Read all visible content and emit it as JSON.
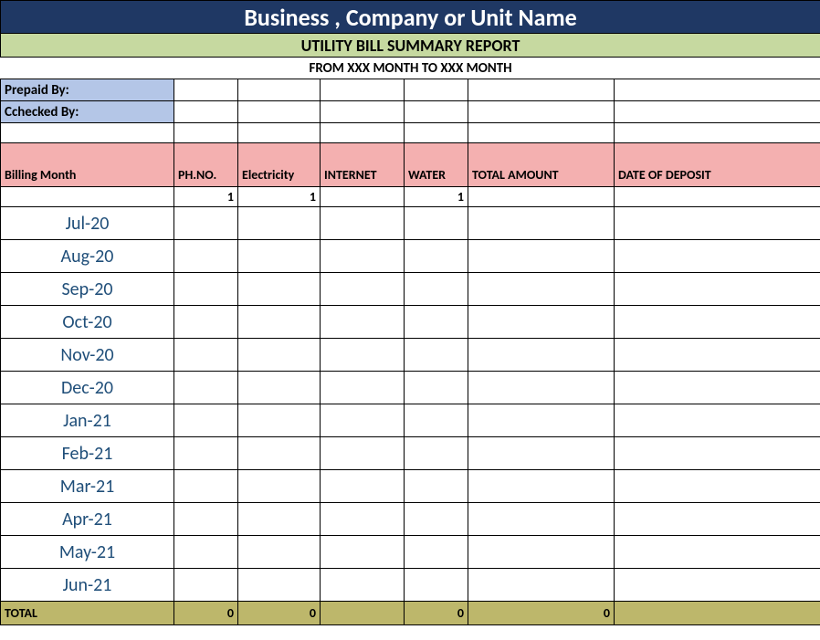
{
  "title": "Business , Company or Unit Name",
  "subtitle": "UTILITY BILL SUMMARY REPORT",
  "period": "FROM XXX MONTH  TO XXX MONTH",
  "meta": {
    "prepaid_label": "Prepaid By:",
    "checked_label": "Cchecked By:"
  },
  "columns": {
    "billing_month": "Billing Month",
    "phno": "PH.NO.",
    "electricity": "Electricity",
    "internet": "INTERNET",
    "water": "WATER",
    "total_amount": "TOTAL AMOUNT",
    "date_deposit": "DATE OF DEPOSIT"
  },
  "initial": {
    "phno": "1",
    "electricity": "1",
    "internet": "",
    "water": "1"
  },
  "months": [
    "Jul-20",
    "Aug-20",
    "Sep-20",
    "Oct-20",
    "Nov-20",
    "Dec-20",
    "Jan-21",
    "Feb-21",
    "Mar-21",
    "Apr-21",
    "May-21",
    "Jun-21"
  ],
  "totals": {
    "label": "TOTAL",
    "phno": "0",
    "electricity": "0",
    "internet": "",
    "water": "0",
    "total_amount": "0"
  }
}
